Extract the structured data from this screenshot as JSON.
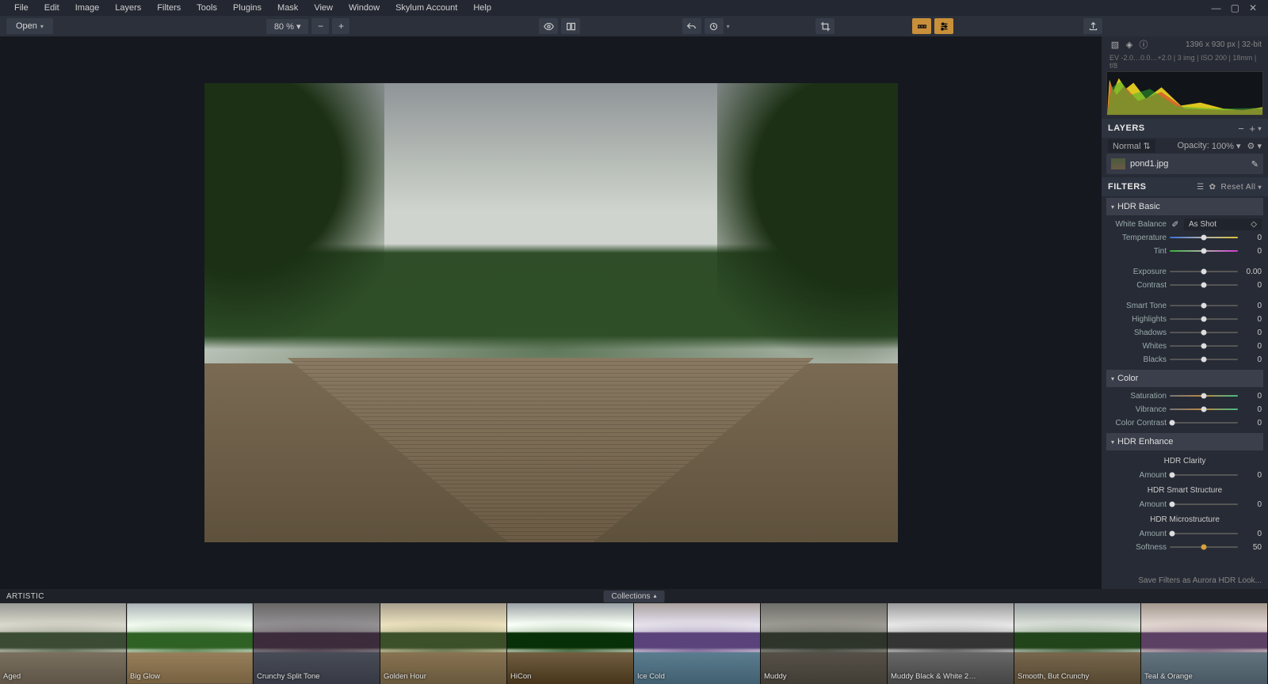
{
  "menu": [
    "File",
    "Edit",
    "Image",
    "Layers",
    "Filters",
    "Tools",
    "Plugins",
    "Mask",
    "View",
    "Window",
    "Skylum Account",
    "Help"
  ],
  "toolbar": {
    "open": "Open",
    "zoom": "80 %"
  },
  "sideinfo": {
    "dims": "1396 x 930 px  |  32-bit",
    "exif": "EV -2.0…0.0…+2.0  |  3 img  |  ISO 200  |  18mm  |  f/8"
  },
  "layers": {
    "title": "LAYERS",
    "blend": "Normal",
    "opacity_label": "Opacity:",
    "opacity": "100%",
    "name": "pond1.jpg"
  },
  "filters": {
    "title": "FILTERS",
    "reset": "Reset All"
  },
  "hdrbasic": {
    "title": "HDR Basic",
    "wb_label": "White Balance",
    "wb_val": "As Shot",
    "temp": "Temperature",
    "tint": "Tint",
    "exposure": "Exposure",
    "contrast": "Contrast",
    "smarttone": "Smart Tone",
    "highlights": "Highlights",
    "shadows": "Shadows",
    "whites": "Whites",
    "blacks": "Blacks",
    "v_temp": "0",
    "v_tint": "0",
    "v_exposure": "0.00",
    "v_contrast": "0",
    "v_smarttone": "0",
    "v_highlights": "0",
    "v_shadows": "0",
    "v_whites": "0",
    "v_blacks": "0"
  },
  "color": {
    "title": "Color",
    "saturation": "Saturation",
    "vibrance": "Vibrance",
    "cc": "Color Contrast",
    "v_saturation": "0",
    "v_vibrance": "0",
    "v_cc": "0"
  },
  "hdrenh": {
    "title": "HDR Enhance",
    "clarity": "HDR Clarity",
    "amount": "Amount",
    "smart": "HDR Smart Structure",
    "micro": "HDR Microstructure",
    "softness": "Softness",
    "v_amount": "0",
    "v_amount2": "0",
    "v_amount3": "0",
    "v_soft": "50"
  },
  "foot": "Save Filters as Aurora HDR Look...",
  "presets": {
    "cat": "ARTISTIC",
    "coll": "Collections",
    "items": [
      "Aged",
      "Big Glow",
      "Crunchy Split Tone",
      "Golden Hour",
      "HiCon",
      "Ice Cold",
      "Muddy",
      "Muddy Black & White 2…",
      "Smooth, But Crunchy",
      "Teal & Orange"
    ],
    "tints": [
      "sepia(.2) saturate(.7)",
      "saturate(1.3) brightness(1.2) blur(.5px)",
      "hue-rotate(190deg) saturate(.6) brightness(.7)",
      "sepia(.4) saturate(1.3)",
      "contrast(1.6) saturate(.8)",
      "hue-rotate(160deg) saturate(1.2) brightness(1.1)",
      "sepia(.3) saturate(.5) brightness(.7)",
      "grayscale(1) contrast(1.3)",
      "contrast(1.2) saturate(.9)",
      "hue-rotate(170deg) sepia(.2) saturate(1.2)"
    ]
  }
}
